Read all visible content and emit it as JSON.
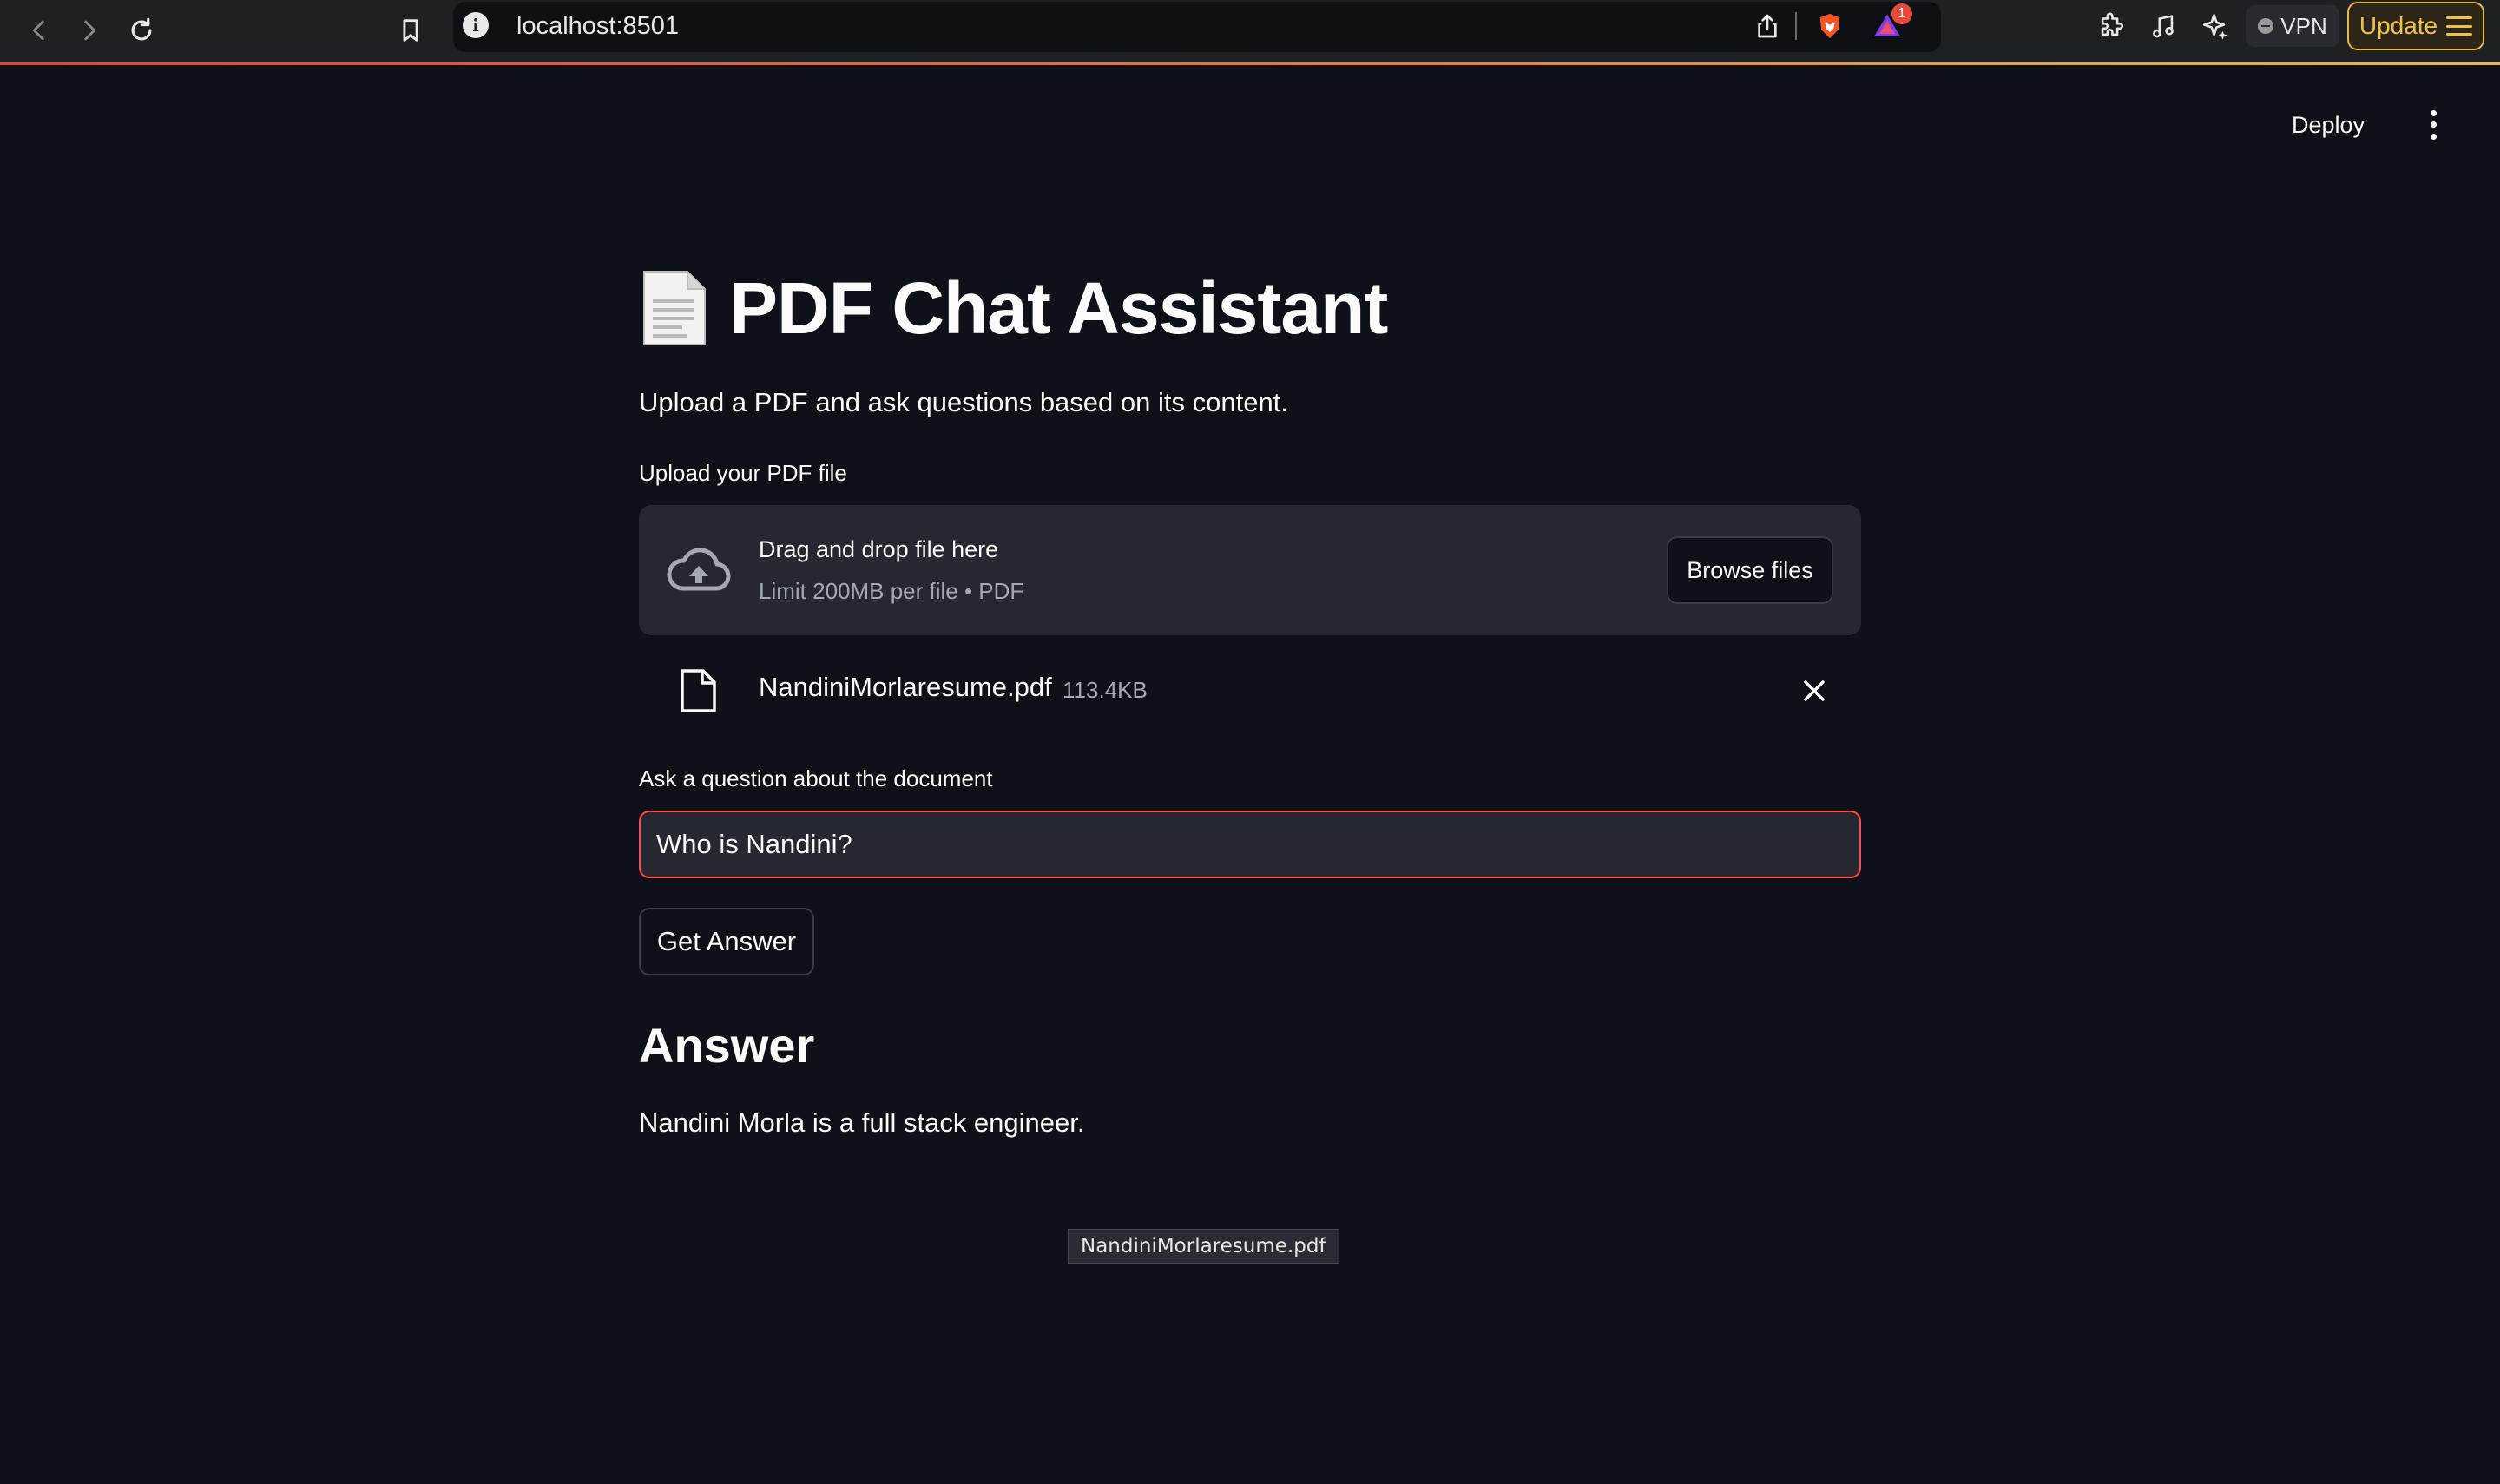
{
  "browser": {
    "url": "localhost:8501",
    "shields_badge": "1",
    "vpn_label": "VPN",
    "update_label": "Update"
  },
  "header": {
    "deploy_label": "Deploy"
  },
  "main": {
    "title": "PDF Chat Assistant",
    "title_icon": "page-facing-up-emoji",
    "subtitle": "Upload a PDF and ask questions based on its content.",
    "upload": {
      "label": "Upload your PDF file",
      "drop_title": "Drag and drop file here",
      "drop_limit": "Limit 200MB per file • PDF",
      "browse_label": "Browse files"
    },
    "file": {
      "name": "NandiniMorlaresume.pdf",
      "size": "113.4KB"
    },
    "question": {
      "label": "Ask a question about the document",
      "value": "Who is Nandini?"
    },
    "get_answer_label": "Get Answer",
    "answer_heading": "Answer",
    "answer_text": "Nandini Morla is a full stack engineer.",
    "tooltip": "NandiniMorlaresume.pdf"
  },
  "colors": {
    "background": "#0e1117",
    "surface": "#262730",
    "accent_red": "#ff4b4b",
    "update_gold": "#f0c14b"
  }
}
